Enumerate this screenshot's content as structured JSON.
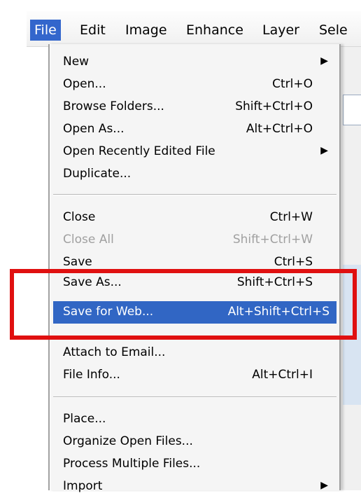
{
  "menubar": {
    "items": [
      "File",
      "Edit",
      "Image",
      "Enhance",
      "Layer",
      "Sele"
    ]
  },
  "file_menu": {
    "items": [
      {
        "label": "New",
        "shortcut": "",
        "submenu": true
      },
      {
        "label": "Open...",
        "shortcut": "Ctrl+O"
      },
      {
        "label": "Browse Folders...",
        "shortcut": "Shift+Ctrl+O"
      },
      {
        "label": "Open As...",
        "shortcut": "Alt+Ctrl+O"
      },
      {
        "label": "Open Recently Edited File",
        "shortcut": "",
        "submenu": true
      },
      {
        "label": "Duplicate...",
        "shortcut": ""
      },
      {
        "label": "Close",
        "shortcut": "Ctrl+W"
      },
      {
        "label": "Close All",
        "shortcut": "Shift+Ctrl+W",
        "disabled": true
      },
      {
        "label": "Save",
        "shortcut": "Ctrl+S"
      },
      {
        "label": "Save As...",
        "shortcut": "Shift+Ctrl+S"
      },
      {
        "label": "Save for Web...",
        "shortcut": "Alt+Shift+Ctrl+S",
        "selected": true
      },
      {
        "label": "Attach to Email...",
        "shortcut": ""
      },
      {
        "label": "File Info...",
        "shortcut": "Alt+Ctrl+I"
      },
      {
        "label": "Place...",
        "shortcut": ""
      },
      {
        "label": "Organize Open Files...",
        "shortcut": ""
      },
      {
        "label": "Process Multiple Files...",
        "shortcut": ""
      },
      {
        "label": "Import",
        "shortcut": "",
        "submenu": true
      }
    ],
    "submenu_arrow": "▶"
  },
  "colors": {
    "selection": "#3166c4",
    "highlight_box": "#e01010",
    "disabled_text": "#a0a0a0"
  }
}
